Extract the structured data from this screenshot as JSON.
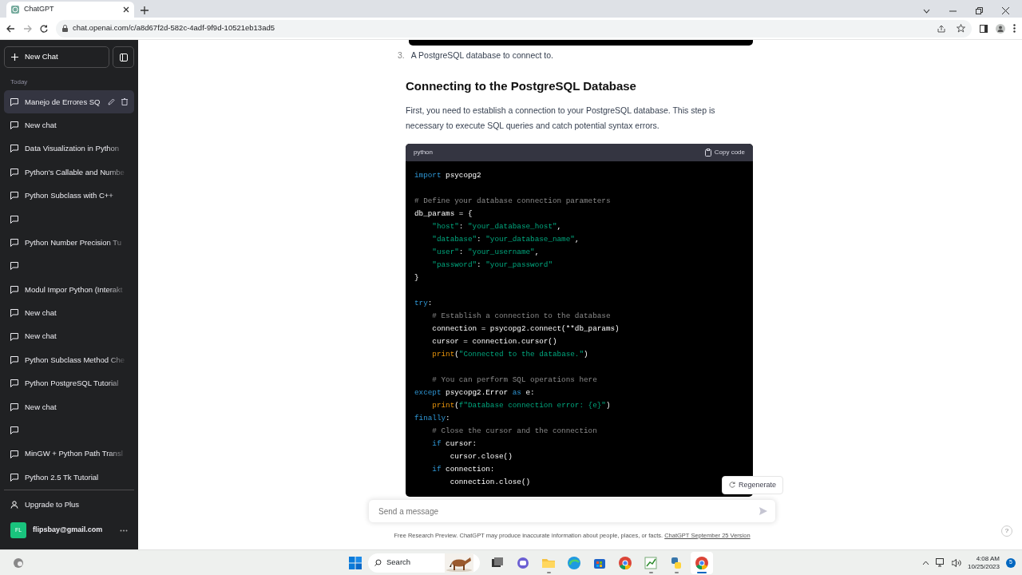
{
  "browser": {
    "tab_title": "ChatGPT",
    "url": "chat.openai.com/c/a8d67f2d-582c-4adf-9f9d-10521eb13ad5"
  },
  "sidebar": {
    "new_chat": "New Chat",
    "section": "Today",
    "items": [
      {
        "title": "Manejo de Errores SQ",
        "selected": true
      },
      {
        "title": "New chat",
        "selected": false
      },
      {
        "title": "Data Visualization in Python",
        "selected": false
      },
      {
        "title": "Python's Callable and Numbe",
        "selected": false
      },
      {
        "title": "Python Subclass with C++",
        "selected": false
      },
      {
        "selected": false
      },
      {
        "title": "Python Number Precision Tu",
        "selected": false
      },
      {
        "selected": false
      },
      {
        "title": "Modul Impor Python (Interakt",
        "selected": false
      },
      {
        "title": "New chat",
        "selected": false
      },
      {
        "title": "New chat",
        "selected": false
      },
      {
        "title": "Python Subclass Method Che",
        "selected": false
      },
      {
        "title": "Python PostgreSQL Tutorial",
        "selected": false
      },
      {
        "title": "New chat",
        "selected": false
      },
      {
        "selected": false
      },
      {
        "title": "MinGW + Python Path Transl",
        "selected": false
      },
      {
        "title": "Python 2.5 Tk Tutorial",
        "selected": false
      }
    ],
    "upgrade": "Upgrade to Plus",
    "user": {
      "initials": "FL",
      "email": "flipsbay@gmail.com"
    }
  },
  "content": {
    "list_item": {
      "number": "3.",
      "text": "A PostgreSQL database to connect to."
    },
    "heading": "Connecting to the PostgreSQL Database",
    "paragraph": "First, you need to establish a connection to your PostgreSQL database. This step is necessary to execute SQL queries and catch potential syntax errors.",
    "code": {
      "language": "python",
      "copy": "Copy code",
      "lines": [
        {
          "kind": "code",
          "tokens": [
            {
              "kind": "k",
              "text": "import"
            },
            {
              "kind": "t",
              "text": " psycopg2"
            }
          ]
        },
        {
          "kind": "blank"
        },
        {
          "kind": "code",
          "tokens": [
            {
              "kind": "c",
              "text": "# Define your database connection parameters"
            }
          ]
        },
        {
          "kind": "code",
          "tokens": [
            {
              "kind": "t",
              "text": "db_params = {"
            }
          ]
        },
        {
          "kind": "code",
          "tokens": [
            {
              "kind": "s",
              "text": "    \"host\""
            },
            {
              "kind": "t",
              "text": ": "
            },
            {
              "kind": "s",
              "text": "\"your_database_host\""
            },
            {
              "kind": "t",
              "text": ","
            }
          ]
        },
        {
          "kind": "code",
          "tokens": [
            {
              "kind": "s",
              "text": "    \"database\""
            },
            {
              "kind": "t",
              "text": ": "
            },
            {
              "kind": "s",
              "text": "\"your_database_name\""
            },
            {
              "kind": "t",
              "text": ","
            }
          ]
        },
        {
          "kind": "code",
          "tokens": [
            {
              "kind": "s",
              "text": "    \"user\""
            },
            {
              "kind": "t",
              "text": ": "
            },
            {
              "kind": "s",
              "text": "\"your_username\""
            },
            {
              "kind": "t",
              "text": ","
            }
          ]
        },
        {
          "kind": "code",
          "tokens": [
            {
              "kind": "s",
              "text": "    \"password\""
            },
            {
              "kind": "t",
              "text": ": "
            },
            {
              "kind": "s",
              "text": "\"your_password\""
            }
          ]
        },
        {
          "kind": "code",
          "tokens": [
            {
              "kind": "t",
              "text": "}"
            }
          ]
        },
        {
          "kind": "blank"
        },
        {
          "kind": "code",
          "tokens": [
            {
              "kind": "k",
              "text": "try"
            },
            {
              "kind": "t",
              "text": ":"
            }
          ]
        },
        {
          "kind": "code",
          "tokens": [
            {
              "kind": "c",
              "text": "    # Establish a connection to the database"
            }
          ]
        },
        {
          "kind": "code",
          "tokens": [
            {
              "kind": "t",
              "text": "    connection = psycopg2.connect(**db_params)"
            }
          ]
        },
        {
          "kind": "code",
          "tokens": [
            {
              "kind": "t",
              "text": "    cursor = connection.cursor()"
            }
          ]
        },
        {
          "kind": "code",
          "tokens": [
            {
              "kind": "f",
              "text": "    print"
            },
            {
              "kind": "t",
              "text": "("
            },
            {
              "kind": "s",
              "text": "\"Connected to the database.\""
            },
            {
              "kind": "t",
              "text": ")"
            }
          ]
        },
        {
          "kind": "blank"
        },
        {
          "kind": "code",
          "tokens": [
            {
              "kind": "c",
              "text": "    # You can perform SQL operations here"
            }
          ]
        },
        {
          "kind": "code",
          "tokens": [
            {
              "kind": "k",
              "text": "except"
            },
            {
              "kind": "t",
              "text": " psycopg2.Error "
            },
            {
              "kind": "k",
              "text": "as"
            },
            {
              "kind": "t",
              "text": " e:"
            }
          ]
        },
        {
          "kind": "code",
          "tokens": [
            {
              "kind": "f",
              "text": "    print"
            },
            {
              "kind": "t",
              "text": "("
            },
            {
              "kind": "s",
              "text": "f\"Database connection error: {e}\""
            },
            {
              "kind": "t",
              "text": ")"
            }
          ]
        },
        {
          "kind": "code",
          "tokens": [
            {
              "kind": "k",
              "text": "finally"
            },
            {
              "kind": "t",
              "text": ":"
            }
          ]
        },
        {
          "kind": "code",
          "tokens": [
            {
              "kind": "c",
              "text": "    # Close the cursor and the connection"
            }
          ]
        },
        {
          "kind": "code",
          "tokens": [
            {
              "kind": "k",
              "text": "    if"
            },
            {
              "kind": "t",
              "text": " cursor:"
            }
          ]
        },
        {
          "kind": "code",
          "tokens": [
            {
              "kind": "t",
              "text": "        cursor.close()"
            }
          ]
        },
        {
          "kind": "code",
          "tokens": [
            {
              "kind": "k",
              "text": "    if"
            },
            {
              "kind": "t",
              "text": " connection:"
            }
          ]
        },
        {
          "kind": "code",
          "tokens": [
            {
              "kind": "t",
              "text": "        connection.close()"
            }
          ]
        }
      ]
    }
  },
  "regenerate": "Regenerate",
  "composer": {
    "placeholder": "Send a message"
  },
  "footer": {
    "text": "Free Research Preview. ChatGPT may produce inaccurate information about people, places, or facts.",
    "link": "ChatGPT September 25 Version"
  },
  "help": "?",
  "taskbar": {
    "search": "Search",
    "apps": [
      {
        "kind": "taskview",
        "running": false,
        "selected": false
      },
      {
        "kind": "chat",
        "running": false,
        "selected": false
      },
      {
        "kind": "folder",
        "running": true,
        "selected": false
      },
      {
        "kind": "edge",
        "running": false,
        "selected": false
      },
      {
        "kind": "store",
        "running": false,
        "selected": false
      },
      {
        "kind": "chrome",
        "running": false,
        "selected": false
      },
      {
        "kind": "chart",
        "running": true,
        "selected": false
      },
      {
        "kind": "python",
        "running": true,
        "selected": false
      },
      {
        "kind": "chrome",
        "running": true,
        "selected": true
      }
    ],
    "time": "4:08 AM",
    "date": "10/25/2023",
    "notifications": "5"
  }
}
